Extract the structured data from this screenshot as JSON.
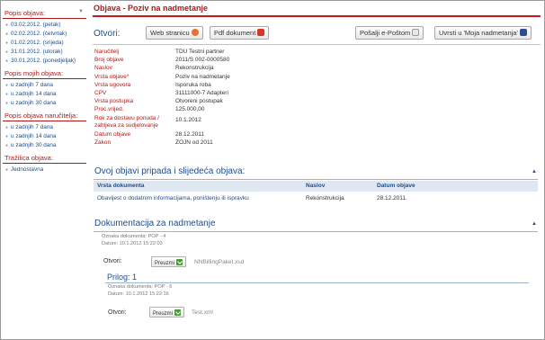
{
  "sidebar": {
    "sections": [
      {
        "title": "Popis objava:",
        "has_arrow": true,
        "items": [
          "03.02.2012. (petak)",
          "02.02.2012. (četvrtak)",
          "01.02.2012. (srijeda)",
          "31.01.2012. (utorak)",
          "30.01.2012. (ponedjeljak)"
        ]
      },
      {
        "title": "Popis mojih objava:",
        "items": [
          "u zadnjih 7 dana",
          "u zadnjih 14 dana",
          "u zadnjih 30 dana"
        ]
      },
      {
        "title": "Popis objava naručitelja:",
        "items": [
          "u zadnjih 7 dana",
          "u zadnjih 14 dana",
          "u zadnjih 30 dana"
        ]
      },
      {
        "title": "Tražilica objava:",
        "items": [
          "Jednostavna"
        ]
      }
    ]
  },
  "main": {
    "title": "Objava - Poziv na nadmetanje",
    "otvori_label": "Otvori:",
    "buttons": {
      "web": "Web stranicu",
      "pdf": "Pdf dokument",
      "email": "Pošalji e-Poštom",
      "moja": "Uvrsti u 'Moja nadmetanja'"
    },
    "details": [
      {
        "label": "Naručitelj",
        "value": "TDU Testni partner"
      },
      {
        "label": "Broj objave",
        "value": "2011/S 002-0000580"
      },
      {
        "label": "Naslov",
        "value": "Rekonstrukcija"
      },
      {
        "label": "Vrsta objave*",
        "value": "Poziv na nadmetanje"
      },
      {
        "label": "Vrsta ugovora",
        "value": "Isporuka roba"
      },
      {
        "label": "CPV",
        "value": "31111000-7 Adapteri"
      },
      {
        "label": "Vrsta postupka",
        "value": "Otvoreni postupak"
      },
      {
        "label": "Proc.vrijed.",
        "value": "125.000,00"
      },
      {
        "label": "Rok za dostavu ponuda / zahtjeva za sudjelovanje",
        "value": "10.1.2012"
      },
      {
        "label": "Datum objave",
        "value": "28.12.2011"
      },
      {
        "label": "Zakon",
        "value": "ZOJN od 2011"
      }
    ],
    "related": {
      "title": "Ovoj objavi pripada i slijedeća objava:",
      "headers": [
        "Vrsta dokumenta",
        "Naslov",
        "Datum objave"
      ],
      "rows": [
        {
          "vrsta": "Obavijest o dodatnim informacijama, poništenju ili ispravku",
          "naslov": "Rekonstrukcija",
          "datum": "28.12.2011."
        }
      ]
    },
    "documentation": {
      "title": "Dokumentacija za nadmetanje",
      "doc1": {
        "oznaka": "Oznaka dokumenta: POP - 4",
        "datum": "Datum: 10.1.2012 15:22:03",
        "otvori": "Otvori:",
        "button": "Preuzmi",
        "file": "NNBillingPaket.xsd"
      },
      "prilog": "Prilog: 1",
      "doc2": {
        "oznaka": "Oznaka dokumenta: POP - 6",
        "datum": "Datum: 10.1.2012 15:22:16",
        "otvori": "Otvori:",
        "button": "Preuzmi",
        "file": "Test.xml"
      }
    }
  },
  "colors": {
    "accent_red": "#b01818",
    "link_blue": "#1f4e8a",
    "table_head": "#dfe7f0"
  }
}
